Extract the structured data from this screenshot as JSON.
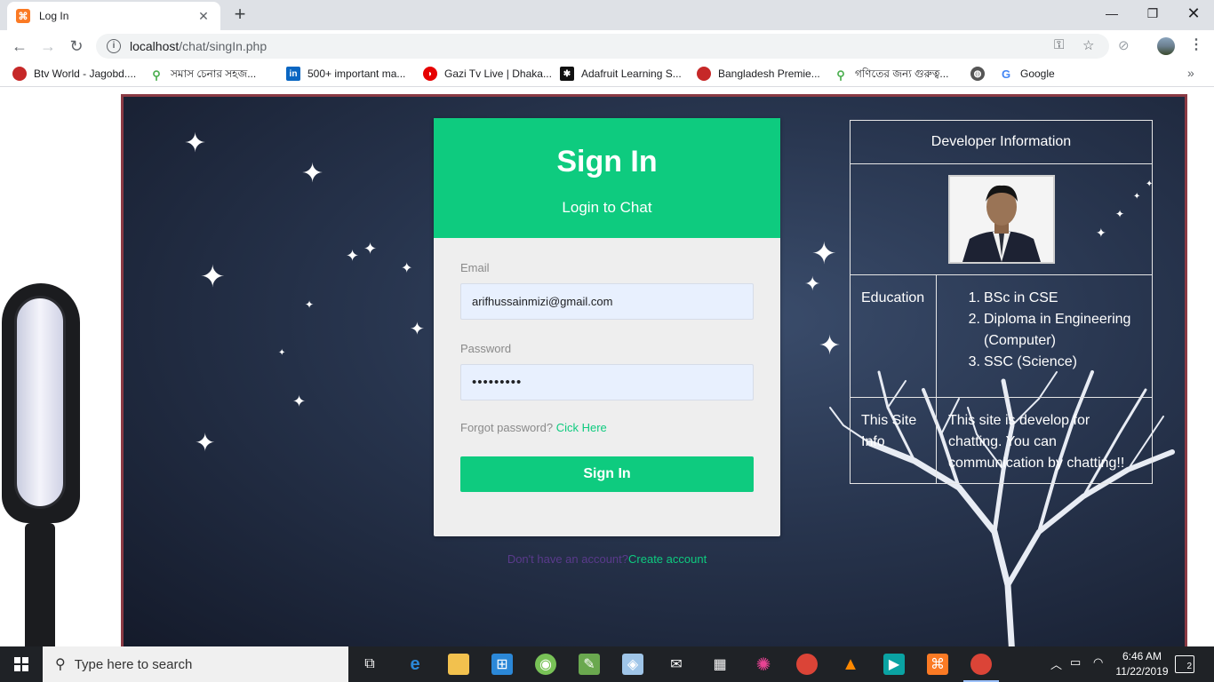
{
  "browser": {
    "tab_title": "Log In",
    "tab_favicon": "xampp-icon",
    "url_host": "localhost",
    "url_path": "/chat/singIn.php",
    "bookmarks": [
      {
        "label": "Btv World - Jagobd....",
        "icon": "red-circle-icon",
        "color": "#c62828"
      },
      {
        "label": "সমাস চেনার সহজ...",
        "icon": "figure-icon",
        "color": "#4caf50"
      },
      {
        "label": "500+ important ma...",
        "icon": "linkedin-icon",
        "color": "#0a66c2"
      },
      {
        "label": "Gazi Tv Live | Dhaka...",
        "icon": "vodafone-icon",
        "color": "#e60000"
      },
      {
        "label": "Adafruit Learning S...",
        "icon": "star-icon",
        "color": "#111111"
      },
      {
        "label": "Bangladesh Premie...",
        "icon": "cricket-ball-icon",
        "color": "#c62828"
      },
      {
        "label": "গণিতের জন্য গুরুত্ব...",
        "icon": "figure-icon",
        "color": "#4caf50"
      },
      {
        "label": "",
        "icon": "globe-icon",
        "color": "#555555"
      },
      {
        "label": "Google",
        "icon": "google-icon",
        "color": "#4285f4"
      }
    ]
  },
  "login": {
    "title": "Sign In",
    "subtitle": "Login to Chat",
    "email_label": "Email",
    "email_value": "arifhussainmizi@gmail.com",
    "password_label": "Password",
    "password_value": "•••••••••",
    "forgot_text": "Forgot password?",
    "forgot_link": "Cick Here",
    "submit_label": "Sign In",
    "no_account_text": "Don't have an account?",
    "create_account_link": "Create account"
  },
  "developer": {
    "heading": "Developer Information",
    "education_label": "Education",
    "education_items": [
      {
        "num": "1.",
        "text": "BSc in CSE"
      },
      {
        "num": "2.",
        "text": "Diploma in Engineering (Computer)"
      },
      {
        "num": "3.",
        "text": "SSC (Science)"
      }
    ],
    "site_info_label": "This Site Info",
    "site_info_text": "This site is develop for chatting. You can communication by chatting!!"
  },
  "taskbar": {
    "search_placeholder": "Type here to search",
    "time": "6:46 AM",
    "date": "11/22/2019",
    "notification_count": "2"
  },
  "colors": {
    "accent": "#0ecb7f",
    "stage_border": "#8a3a44"
  }
}
